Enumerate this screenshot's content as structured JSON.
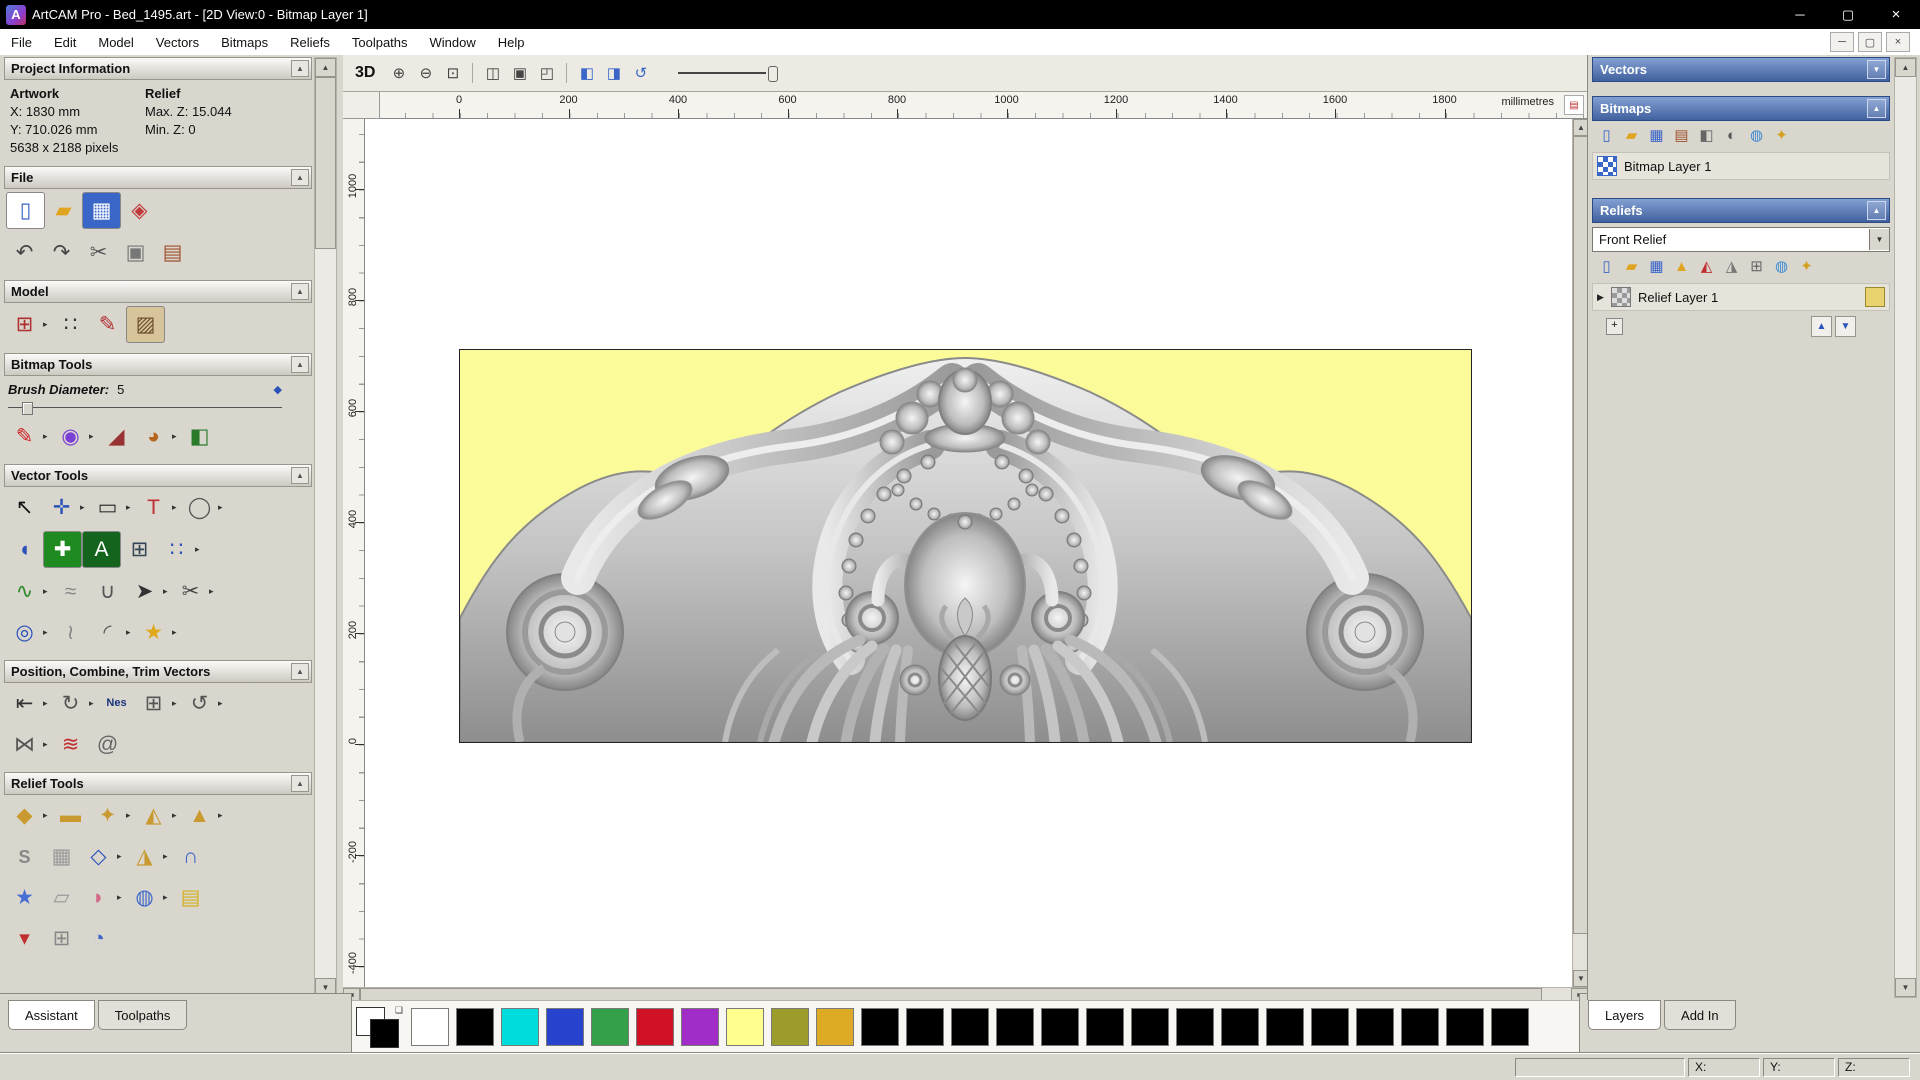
{
  "window": {
    "title": "ArtCAM Pro - Bed_1495.art - [2D View:0 - Bitmap Layer 1]",
    "logo": "A",
    "controls": [
      {
        "n": "minimize-button",
        "g": "─"
      },
      {
        "n": "maximize-button",
        "g": "▢"
      },
      {
        "n": "close-button",
        "g": "×"
      }
    ]
  },
  "menu": {
    "items": [
      "File",
      "Edit",
      "Model",
      "Vectors",
      "Bitmaps",
      "Reliefs",
      "Toolpaths",
      "Window",
      "Help"
    ],
    "mdi_controls": [
      {
        "n": "mdi-minimize-button",
        "g": "─"
      },
      {
        "n": "mdi-restore-button",
        "g": "▢"
      },
      {
        "n": "mdi-close-button",
        "g": "×"
      }
    ]
  },
  "icons": {
    "up": "▲",
    "down": "▼",
    "left": "◄",
    "right": "►",
    "dropdown": "▼",
    "flyout": "▸",
    "plus": "+",
    "expand": "▶",
    "overlap": "❏"
  },
  "left_panel": {
    "project_info": {
      "title": "Project Information",
      "artwork_label": "Artwork",
      "relief_label": "Relief",
      "x_value": "X: 1830 mm",
      "y_value": "Y: 710.026 mm",
      "pixels": "5638 x 2188 pixels",
      "max_z": "Max. Z: 15.044",
      "min_z": "Min. Z: 0"
    },
    "file": {
      "title": "File",
      "row1": [
        {
          "n": "new-model-icon",
          "g": "▯",
          "c": "#3a66c8",
          "bg": "#ffffff"
        },
        {
          "n": "open-model-icon",
          "g": "▰",
          "c": "#e0a520"
        },
        {
          "n": "save-model-icon",
          "g": "▦",
          "c": "#ffffff",
          "bg": "#3a66c8"
        },
        {
          "n": "clipart-library-icon",
          "g": "◈",
          "c": "#c03a3a"
        }
      ],
      "row2": [
        {
          "n": "undo-icon",
          "g": "↶",
          "c": "#444444"
        },
        {
          "n": "redo-icon",
          "g": "↷",
          "c": "#444444"
        },
        {
          "n": "cut-icon",
          "g": "✂",
          "c": "#555555"
        },
        {
          "n": "copy-icon",
          "g": "▣",
          "c": "#777777"
        },
        {
          "n": "paste-icon",
          "g": "▤",
          "c": "#a0522d"
        }
      ]
    },
    "model": {
      "title": "Model",
      "row": [
        {
          "n": "set-model-size-icon",
          "g": "⊞",
          "c": "#b03030",
          "d": true
        },
        {
          "n": "set-position-icon",
          "g": "∷",
          "c": "#333333"
        },
        {
          "n": "notes-icon",
          "g": "✎",
          "c": "#b03030"
        },
        {
          "n": "lighting-material-icon",
          "g": "▨",
          "c": "#6a4f2a",
          "bg": "#d8c49a"
        }
      ]
    },
    "bitmap_tools": {
      "title": "Bitmap Tools",
      "brush_label": "Brush Diameter:",
      "brush_value": "5",
      "row": [
        {
          "n": "paint-icon",
          "g": "✎",
          "c": "#cc2020",
          "d": true
        },
        {
          "n": "colour-blend-icon",
          "g": "◉",
          "c": "#7a3fd4",
          "d": true
        },
        {
          "n": "pick-colour-icon",
          "g": "◢",
          "c": "#993333"
        },
        {
          "n": "palette-icon",
          "g": "◕",
          "c": "#b5651d",
          "d": true
        },
        {
          "n": "flood-fill-icon",
          "g": "◧",
          "c": "#2a7a2a"
        }
      ]
    },
    "vector_tools": {
      "title": "Vector Tools",
      "rows": [
        [
          {
            "n": "select-vectors-icon",
            "g": "↖",
            "c": "#111111"
          },
          {
            "n": "transform-vectors-icon",
            "g": "✛",
            "c": "#2a52b8",
            "d": true
          },
          {
            "n": "create-rectangle-icon",
            "g": "▭",
            "c": "#333333",
            "d": true
          },
          {
            "n": "create-text-icon",
            "g": "T",
            "c": "#c03030",
            "d": true
          },
          {
            "n": "create-ellipse-icon",
            "g": "◯",
            "c": "#555555",
            "d": true
          }
        ],
        [
          {
            "n": "offset-vector-icon",
            "g": "◖",
            "c": "#2a52b8"
          },
          {
            "n": "node-editing-icon",
            "g": "✚",
            "c": "#ffffff",
            "bg": "#1f8a1f"
          },
          {
            "n": "text-on-curve-icon",
            "g": "A",
            "c": "#ffffff",
            "bg": "#14641e"
          },
          {
            "n": "vector-grid-icon",
            "g": "⊞",
            "c": "#334455"
          },
          {
            "n": "paste-along-curve-icon",
            "g": "∷",
            "c": "#2a52b8",
            "d": true
          }
        ],
        [
          {
            "n": "bitmap-to-vector-icon",
            "g": "∿",
            "c": "#2a8a2a",
            "d": true
          },
          {
            "n": "smooth-vector-icon",
            "g": "≈",
            "c": "#888888"
          },
          {
            "n": "edit-curve-icon",
            "g": "∪",
            "c": "#555555"
          },
          {
            "n": "create-polyline-icon",
            "g": "➤",
            "c": "#333333",
            "d": true
          },
          {
            "n": "trim-vectors-icon",
            "g": "✂",
            "c": "#444444",
            "d": true
          }
        ],
        [
          {
            "n": "create-circle-icon",
            "g": "◎",
            "c": "#2a52b8",
            "d": true
          },
          {
            "n": "freehand-curve-icon",
            "g": "≀",
            "c": "#888888"
          },
          {
            "n": "create-arc-icon",
            "g": "◜",
            "c": "#555555",
            "d": true
          },
          {
            "n": "create-star-icon",
            "g": "★",
            "c": "#e0a818",
            "d": true
          }
        ]
      ]
    },
    "position_tools": {
      "title": "Position, Combine, Trim Vectors",
      "rows": [
        [
          {
            "n": "align-vectors-icon",
            "g": "⇤",
            "c": "#333333",
            "d": true
          },
          {
            "n": "circular-array-icon",
            "g": "↻",
            "c": "#555555",
            "d": true
          },
          {
            "n": "nesting-icon",
            "g": "Nes",
            "c": "#16327e",
            "fs": 11
          },
          {
            "n": "block-copy-icon",
            "g": "⊞",
            "c": "#555555",
            "d": true
          },
          {
            "n": "copy-rotate-icon",
            "g": "↺",
            "c": "#555555",
            "d": true
          }
        ],
        [
          {
            "n": "mirror-vectors-icon",
            "g": "⋈",
            "c": "#555555",
            "d": true
          },
          {
            "n": "weld-vectors-icon",
            "g": "≋",
            "c": "#c03030"
          },
          {
            "n": "spiral-icon",
            "g": "@",
            "c": "#666666"
          }
        ]
      ]
    },
    "relief_tools": {
      "title": "Relief Tools",
      "rows": [
        [
          {
            "n": "shape-editor-icon",
            "g": "◆",
            "c": "#c89a30",
            "d": true
          },
          {
            "n": "smooth-relief-icon",
            "g": "▬",
            "c": "#c89a30"
          },
          {
            "n": "sculpt-relief-icon",
            "g": "✦",
            "c": "#c89a30",
            "d": true
          },
          {
            "n": "paste-relief-icon",
            "g": "◭",
            "c": "#c89a30",
            "d": true
          },
          {
            "n": "raise-relief-icon",
            "g": "▲",
            "c": "#c89a30",
            "d": true
          }
        ],
        [
          {
            "n": "swept-profile-icon",
            "g": "S",
            "c": "#888888",
            "fs": 18
          },
          {
            "n": "texture-relief-icon",
            "g": "▦",
            "c": "#999999"
          },
          {
            "n": "two-rail-sweep-icon",
            "g": "◇",
            "c": "#2a52b8",
            "d": true
          },
          {
            "n": "turn-relief-icon",
            "g": "◮",
            "c": "#c89a30",
            "d": true
          },
          {
            "n": "interactive-sculpt-icon",
            "g": "∩",
            "c": "#3a66c8"
          }
        ],
        [
          {
            "n": "star-relief-icon",
            "g": "★",
            "c": "#4a6fd4"
          },
          {
            "n": "envelope-distort-icon",
            "g": "▱",
            "c": "#999999"
          },
          {
            "n": "fan-relief-icon",
            "g": "◗",
            "c": "#d46a8a",
            "d": true
          },
          {
            "n": "dome-relief-icon",
            "g": "◍",
            "c": "#3a66c8",
            "d": true
          },
          {
            "n": "relief-layer-stack-icon",
            "g": "▤",
            "c": "#d4b020"
          }
        ],
        [
          {
            "n": "zero-relief-icon",
            "g": "▾",
            "c": "#c03030"
          },
          {
            "n": "relief-clipart-icon",
            "g": "⊞",
            "c": "#888888"
          },
          {
            "n": "offset-relief-icon",
            "g": "◔",
            "c": "#3a66c8"
          }
        ]
      ]
    },
    "tabs": [
      {
        "label": "Assistant",
        "active": true
      },
      {
        "label": "Toolpaths",
        "active": false
      }
    ]
  },
  "toolbar": {
    "view3d": "3D",
    "items": [
      {
        "n": "zoom-in-icon",
        "g": "⊕",
        "c": "#444444"
      },
      {
        "n": "zoom-out-icon",
        "g": "⊖",
        "c": "#444444"
      },
      {
        "n": "zoom-box-icon",
        "g": "⊡",
        "c": "#444444"
      },
      {
        "sep": true
      },
      {
        "n": "zoom-1to1-icon",
        "g": "◫",
        "c": "#444444"
      },
      {
        "n": "zoom-fit-icon",
        "g": "▣",
        "c": "#444444"
      },
      {
        "n": "zoom-object-icon",
        "g": "◰",
        "c": "#444444"
      },
      {
        "sep": true
      },
      {
        "n": "snap-toggle-icon",
        "g": "◧",
        "c": "#3a66c8"
      },
      {
        "n": "preview-toggle-icon",
        "g": "◨",
        "c": "#3a66c8"
      },
      {
        "n": "refresh-view-icon",
        "g": "↺",
        "c": "#3a66c8"
      }
    ]
  },
  "ruler": {
    "h_ticks": [
      "0",
      "200",
      "400",
      "600",
      "800",
      "1000",
      "1200",
      "1400",
      "1600",
      "1800"
    ],
    "v_ticks": [
      "1000",
      "800",
      "600",
      "400",
      "200",
      "0",
      "-200",
      "-400"
    ],
    "units": "millimetres"
  },
  "right_panel": {
    "vectors": {
      "title": "Vectors"
    },
    "bitmaps": {
      "title": "Bitmaps",
      "toolbar": [
        {
          "n": "new-bitmap-icon",
          "g": "▯",
          "c": "#3a66c8"
        },
        {
          "n": "open-bitmap-icon",
          "g": "▰",
          "c": "#e0a520"
        },
        {
          "n": "save-bitmap-icon",
          "g": "▦",
          "c": "#3a66c8"
        },
        {
          "n": "paste-bitmap-icon",
          "g": "▤",
          "c": "#a0522d"
        },
        {
          "n": "greyscale-icon",
          "g": "◧",
          "c": "#666666"
        },
        {
          "n": "adjust-colours-icon",
          "g": "◐",
          "c": "#555555"
        },
        {
          "n": "transparency-icon",
          "g": "◍",
          "c": "#3a8ad4"
        },
        {
          "n": "new-bitmap-layer-icon",
          "g": "✦",
          "c": "#d4a020"
        }
      ],
      "layer_label": "Bitmap Layer 1"
    },
    "reliefs": {
      "title": "Reliefs",
      "combo_value": "Front Relief",
      "toolbar": [
        {
          "n": "new-relief-icon",
          "g": "▯",
          "c": "#3a66c8"
        },
        {
          "n": "open-relief-icon",
          "g": "▰",
          "c": "#e0a520"
        },
        {
          "n": "save-relief-icon",
          "g": "▦",
          "c": "#3a66c8"
        },
        {
          "n": "import-relief-icon",
          "g": "▲",
          "c": "#e0a520"
        },
        {
          "n": "reset-relief-icon",
          "g": "◭",
          "c": "#c03030"
        },
        {
          "n": "invert-relief-icon",
          "g": "◮",
          "c": "#777777"
        },
        {
          "n": "calculate-relief-icon",
          "g": "⊞",
          "c": "#666666"
        },
        {
          "n": "smooth-relief-small-icon",
          "g": "◍",
          "c": "#3a8ad4"
        },
        {
          "n": "new-relief-layer-icon",
          "g": "✦",
          "c": "#d4a020"
        }
      ],
      "layer_label": "Relief Layer 1"
    },
    "tabs": [
      {
        "label": "Layers",
        "active": true
      },
      {
        "label": "Add In",
        "active": false
      }
    ]
  },
  "palette": {
    "primary": "#ffffff",
    "secondary": "#000000",
    "swatches": [
      "#ffffff",
      "#000000",
      "#00dcdc",
      "#2742cc",
      "#35a04a",
      "#d01226",
      "#a22cc8",
      "#ffff8e",
      "#9c9c2a",
      "#dcaa24",
      "#000000",
      "#000000",
      "#000000",
      "#000000",
      "#000000",
      "#000000",
      "#000000",
      "#000000",
      "#000000",
      "#000000",
      "#000000",
      "#000000",
      "#000000",
      "#000000",
      "#000000"
    ]
  },
  "status_bar": {
    "x_label": "X:",
    "y_label": "Y:",
    "z_label": "Z:"
  }
}
